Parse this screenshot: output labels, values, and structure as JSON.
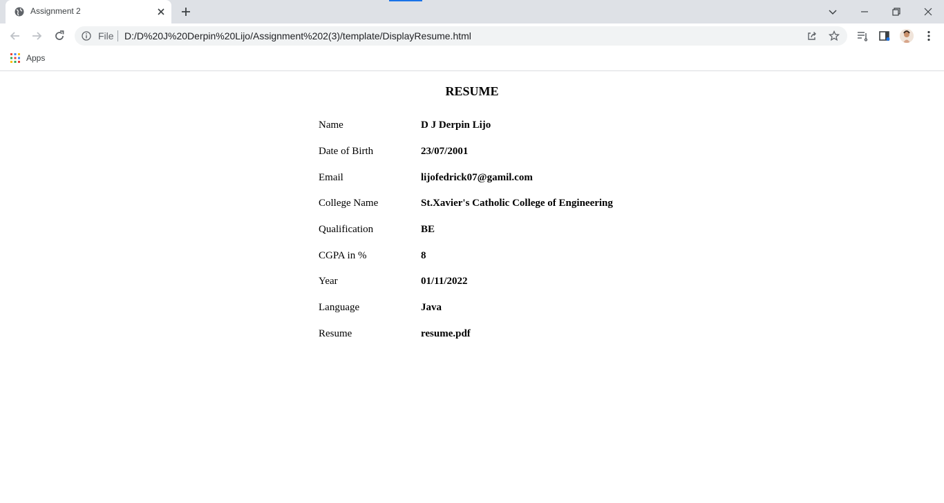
{
  "browser": {
    "tab_title": "Assignment 2",
    "address_scheme": "File",
    "url": "D:/D%20J%20Derpin%20Lijo/Assignment%202(3)/template/DisplayResume.html",
    "bookmark_apps_label": "Apps",
    "accent_color": "#1a73e8"
  },
  "page": {
    "heading": "RESUME",
    "rows": [
      {
        "label": "Name",
        "value": "D J Derpin Lijo"
      },
      {
        "label": "Date of Birth",
        "value": "23/07/2001"
      },
      {
        "label": "Email",
        "value": "lijofedrick07@gamil.com"
      },
      {
        "label": "College Name",
        "value": "St.Xavier's Catholic College of Engineering"
      },
      {
        "label": "Qualification",
        "value": "BE"
      },
      {
        "label": "CGPA in %",
        "value": "8"
      },
      {
        "label": "Year",
        "value": "01/11/2022"
      },
      {
        "label": "Language",
        "value": "Java"
      },
      {
        "label": "Resume",
        "value": "resume.pdf"
      }
    ]
  }
}
